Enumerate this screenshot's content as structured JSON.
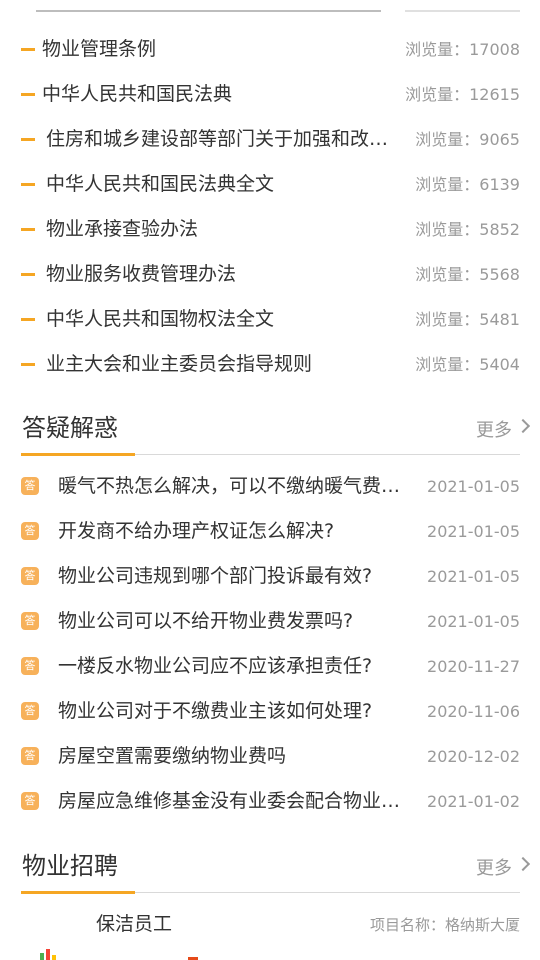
{
  "laws": {
    "items": [
      {
        "title": "物业管理条例",
        "views": "浏览量：17008"
      },
      {
        "title": "中华人民共和国民法典",
        "views": "浏览量：12615"
      },
      {
        "title": "住房和城乡建设部等部门关于加强和改进住宅物业管理工作的通知",
        "views": "浏览量：9065"
      },
      {
        "title": "中华人民共和国民法典全文",
        "views": "浏览量：6139"
      },
      {
        "title": "物业承接查验办法",
        "views": "浏览量：5852"
      },
      {
        "title": "物业服务收费管理办法",
        "views": "浏览量：5568"
      },
      {
        "title": "中华人民共和国物权法全文",
        "views": "浏览量：5481"
      },
      {
        "title": "业主大会和业主委员会指导规则",
        "views": "浏览量：5404"
      }
    ]
  },
  "qa": {
    "title": "答疑解惑",
    "more": "更多",
    "badge": "答",
    "items": [
      {
        "title": "暖气不热怎么解决，可以不缴纳暖气费吗？",
        "date": "2021-01-05"
      },
      {
        "title": "开发商不给办理产权证怎么解决?",
        "date": "2021-01-05"
      },
      {
        "title": "物业公司违规到哪个部门投诉最有效?",
        "date": "2021-01-05"
      },
      {
        "title": "物业公司可以不给开物业费发票吗?",
        "date": "2021-01-05"
      },
      {
        "title": "一楼反水物业公司应不应该承担责任?",
        "date": "2020-11-27"
      },
      {
        "title": "物业公司对于不缴费业主该如何处理?",
        "date": "2020-11-06"
      },
      {
        "title": "房屋空置需要缴纳物业费吗",
        "date": "2020-12-02"
      },
      {
        "title": "房屋应急维修基金没有业委会配合物业怎么办",
        "date": "2021-01-02"
      }
    ]
  },
  "jobs": {
    "title": "物业招聘",
    "more": "更多",
    "first": {
      "title": "保洁员工",
      "project": "项目名称：格纳斯大厦"
    }
  },
  "colors": {
    "accent": "#f5a623",
    "badge": "#f7b15a"
  }
}
